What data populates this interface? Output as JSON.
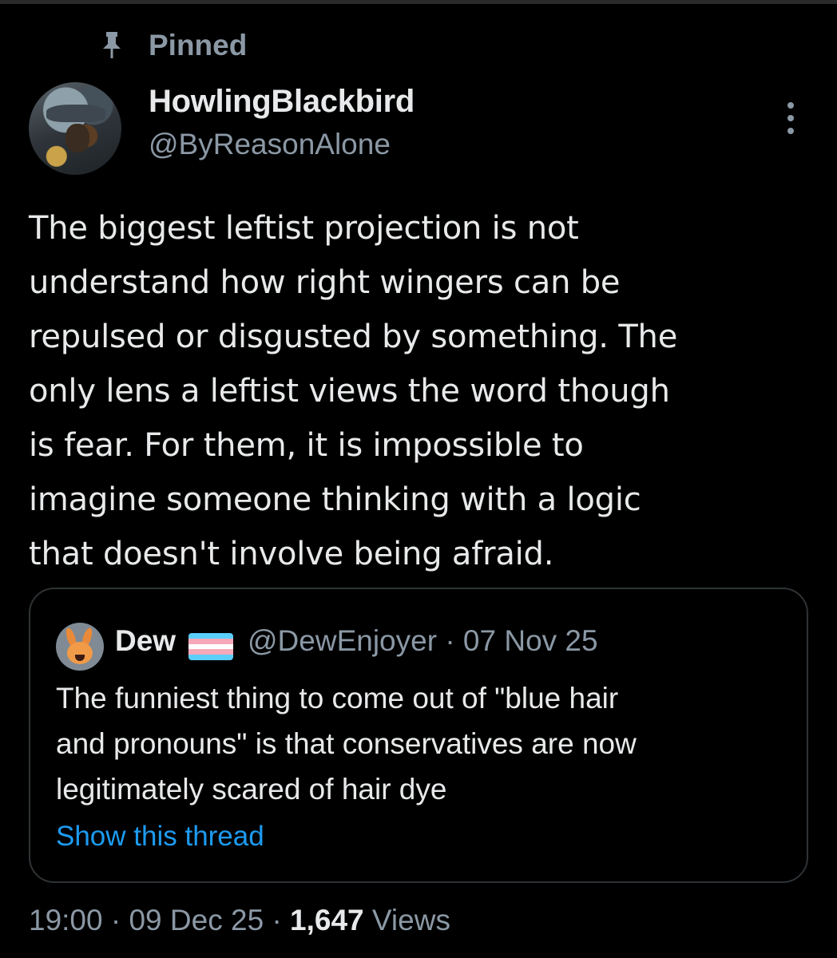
{
  "pinned": {
    "label": "Pinned"
  },
  "author": {
    "display_name": "HowlingBlackbird",
    "handle": "@ByReasonAlone"
  },
  "tweet": {
    "lines": [
      "The biggest leftist projection is not",
      "understand how right wingers can be",
      "repulsed or disgusted by something. The",
      "only lens a leftist views the word though",
      "is fear. For them, it is impossible to",
      "imagine someone thinking with a logic",
      "that doesn't involve being afraid."
    ]
  },
  "quote": {
    "display_name": "Dew",
    "flag": "transgender-flag",
    "flag_colors": [
      "#5bcefa",
      "#f5a9b8",
      "#ffffff",
      "#f5a9b8",
      "#5bcefa"
    ],
    "handle": "@DewEnjoyer",
    "separator": "·",
    "date": "07 Nov 25",
    "lines": [
      "The funniest thing to come out of \"blue hair",
      "and pronouns\" is that conservatives are now",
      "legitimately scared of hair dye"
    ],
    "show_thread": "Show this thread"
  },
  "footer": {
    "time": "19:00",
    "sep1": "·",
    "date": "09 Dec 25",
    "sep2": "·",
    "views_count": "1,647",
    "views_label": "Views"
  },
  "colors": {
    "background": "#000000",
    "text_primary": "#e7e9ea",
    "text_secondary": "#8b98a5",
    "link": "#1d9bf0",
    "border": "#2f3336"
  },
  "icons": {
    "pin": "pin-icon",
    "more": "more-options-icon"
  }
}
